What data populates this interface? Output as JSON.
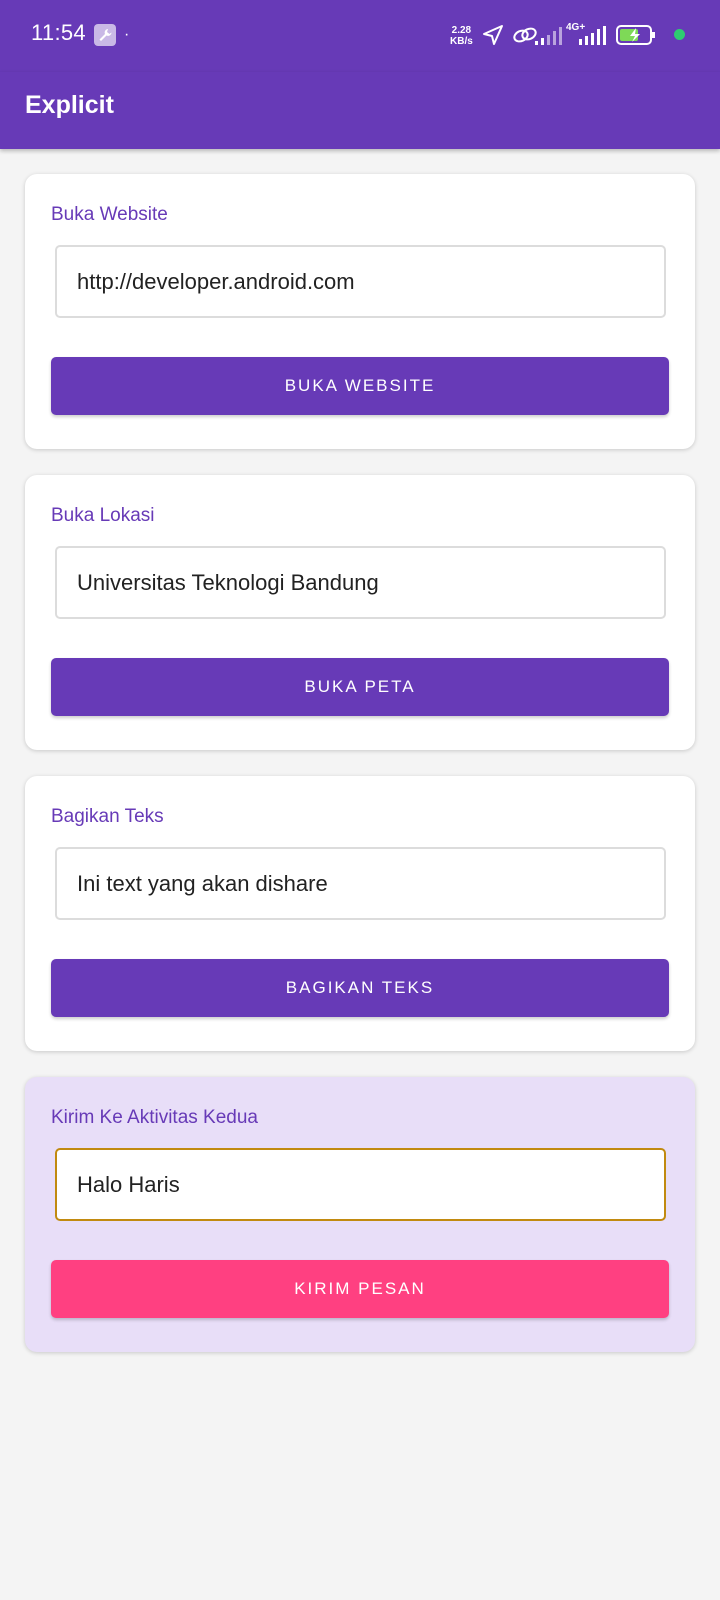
{
  "status_bar": {
    "time": "11:54",
    "dot": "·",
    "speed_value": "2.28",
    "speed_unit": "KB/s",
    "network": "4G+",
    "icons": [
      "wrench-icon",
      "location-arrow-icon",
      "link-icon",
      "signal-icon",
      "signal-4g-icon",
      "battery-charging-icon"
    ]
  },
  "app_bar": {
    "title": "Explicit"
  },
  "cards": [
    {
      "label": "Buka Website",
      "value": "http://developer.android.com",
      "button": "BUKA WEBSITE"
    },
    {
      "label": "Buka Lokasi",
      "value": "Universitas Teknologi Bandung",
      "button": "BUKA PETA"
    },
    {
      "label": "Bagikan Teks",
      "value": "Ini text yang akan dishare",
      "button": "BAGIKAN TEKS"
    },
    {
      "label": "Kirim Ke Aktivitas Kedua",
      "value": "Halo Haris",
      "button": "KIRIM PESAN"
    }
  ],
  "colors": {
    "primary": "#673ab7",
    "accent": "#ff4081",
    "card_alt": "#e8def8",
    "focus_border": "#c18a10"
  }
}
